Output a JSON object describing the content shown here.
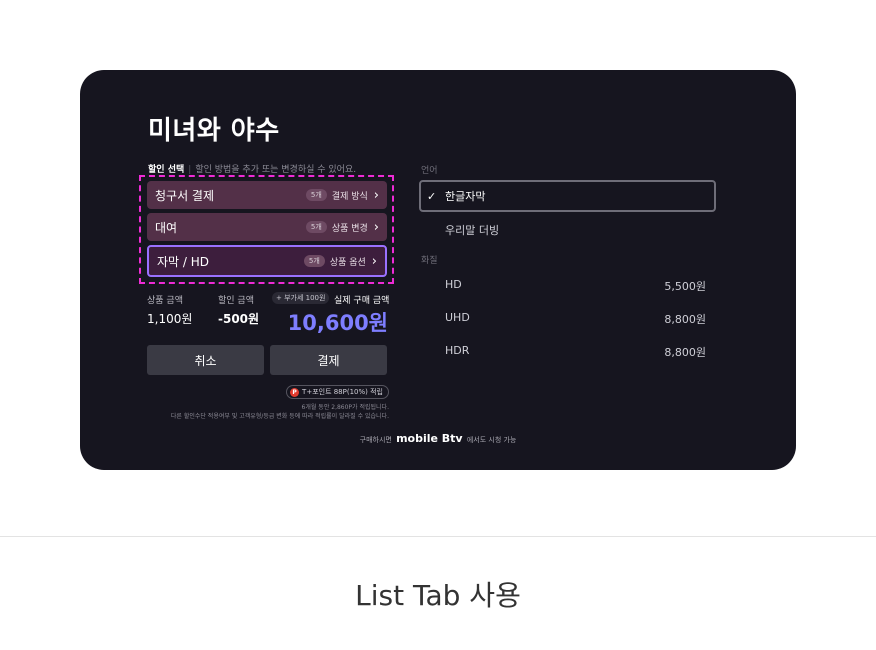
{
  "title": "미녀와 야수",
  "discount": {
    "heading": "할인 선택",
    "hint": "할인 방법을 추가 또는 변경하실 수 있어요."
  },
  "options": [
    {
      "label": "청구서 결제",
      "badge": "5개",
      "action": "결제 방식"
    },
    {
      "label": "대여",
      "badge": "5개",
      "action": "상품 변경"
    },
    {
      "label": "자막 / HD",
      "badge": "5개",
      "action": "상품 옵션"
    }
  ],
  "price": {
    "product_label": "상품 금액",
    "product_value": "1,100원",
    "discount_label": "할인 금액",
    "discount_value": "-500원",
    "vat_label": "+ 부가세 100원",
    "final_label": "실제 구매 금액",
    "final_value": "10,600원"
  },
  "buttons": {
    "cancel": "취소",
    "pay": "결제"
  },
  "point": {
    "icon": "P",
    "text": "T+포인트 88P(10%) 적립"
  },
  "notes": {
    "line1": "6개월 동안 2,860P가 적립됩니다.",
    "line2": "다른 할인수단 적용여부 및 고객유형/등급 변화 등에 따라 적립률이 달라질 수 있습니다."
  },
  "footer": {
    "pre": "구매하시면",
    "brand": "mobile Btv",
    "post": "에서도 시청 가능"
  },
  "language": {
    "label": "언어",
    "selected": "한글자막",
    "other": "우리말 더빙"
  },
  "quality": {
    "label": "화질",
    "items": [
      {
        "name": "HD",
        "price": "5,500원"
      },
      {
        "name": "UHD",
        "price": "8,800원"
      },
      {
        "name": "HDR",
        "price": "8,800원"
      }
    ]
  },
  "caption": "List Tab 사용",
  "colors": {
    "panel_bg": "#16151f",
    "dashed_highlight": "#ee2bd6",
    "selected_border": "#9a71ff",
    "final_price": "#7e7eff"
  }
}
